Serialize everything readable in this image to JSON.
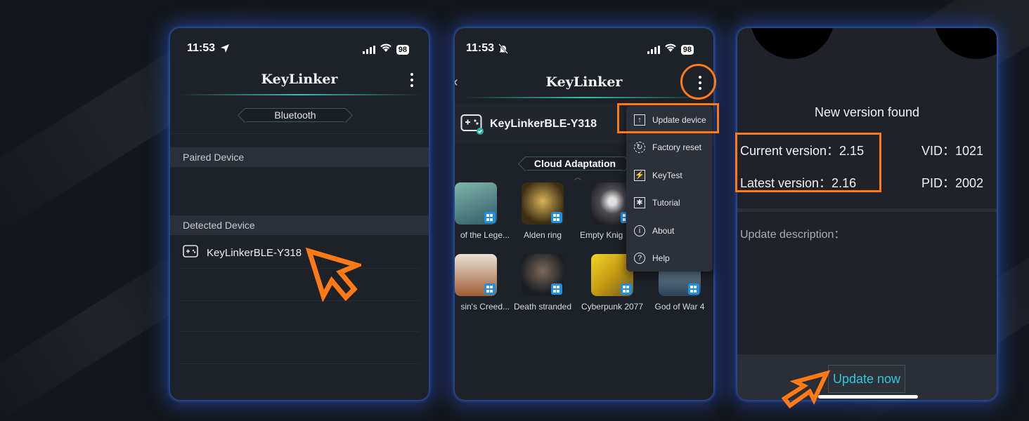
{
  "colors": {
    "accent": "#ff7a14",
    "teal": "#2cc6b0",
    "update_text": "#31c6dd",
    "glow": "#2a5ad8"
  },
  "screen1": {
    "time": "11:53",
    "battery": "98",
    "title": "KeyLinker",
    "tab": "Bluetooth",
    "paired_header": "Paired Device",
    "detected_header": "Detected Device",
    "device_name": "KeyLinkerBLE-Y318",
    "icons": [
      "location-arrow-icon",
      "signal-icon",
      "wifi-icon",
      "battery-icon",
      "more-vertical-icon",
      "gamepad-icon",
      "cursor-arrow-icon"
    ]
  },
  "screen2": {
    "time": "11:53",
    "battery": "98",
    "title": "KeyLinker",
    "device_name": "KeyLinkerBLE-Y318",
    "section_title": "Cloud Adaptation",
    "games": [
      {
        "name": "of the Lege...",
        "color": "#4d8a8d"
      },
      {
        "name": "Alden ring",
        "color": "#5b4a22"
      },
      {
        "name": "Empty Knig",
        "color": "#3a3a40"
      },
      {
        "name": "sin's Creed...",
        "color": "#8a5a3a"
      },
      {
        "name": "Death stranded",
        "color": "#2b3035"
      },
      {
        "name": "Cyberpunk 2077",
        "color": "#c9a51c"
      },
      {
        "name": "God of War 4",
        "color": "#3e5468"
      }
    ],
    "menu": [
      {
        "label": "Update device",
        "icon": "upload-box-icon",
        "glyph": "↑"
      },
      {
        "label": "Factory reset",
        "icon": "reset-icon",
        "glyph": "↻"
      },
      {
        "label": "KeyTest",
        "icon": "keytest-icon",
        "glyph": "⚡"
      },
      {
        "label": "Tutorial",
        "icon": "tutorial-icon",
        "glyph": "✱"
      },
      {
        "label": "About",
        "icon": "info-icon",
        "glyph": "i"
      },
      {
        "label": "Help",
        "icon": "help-icon",
        "glyph": "?"
      }
    ]
  },
  "screen3": {
    "title": "New version found",
    "current_version": "Current version：2.15",
    "latest_version": "Latest version：2.16",
    "vid": "VID：1021",
    "pid": "PID：2002",
    "description_label": "Update description：",
    "update_button": "Update now"
  }
}
